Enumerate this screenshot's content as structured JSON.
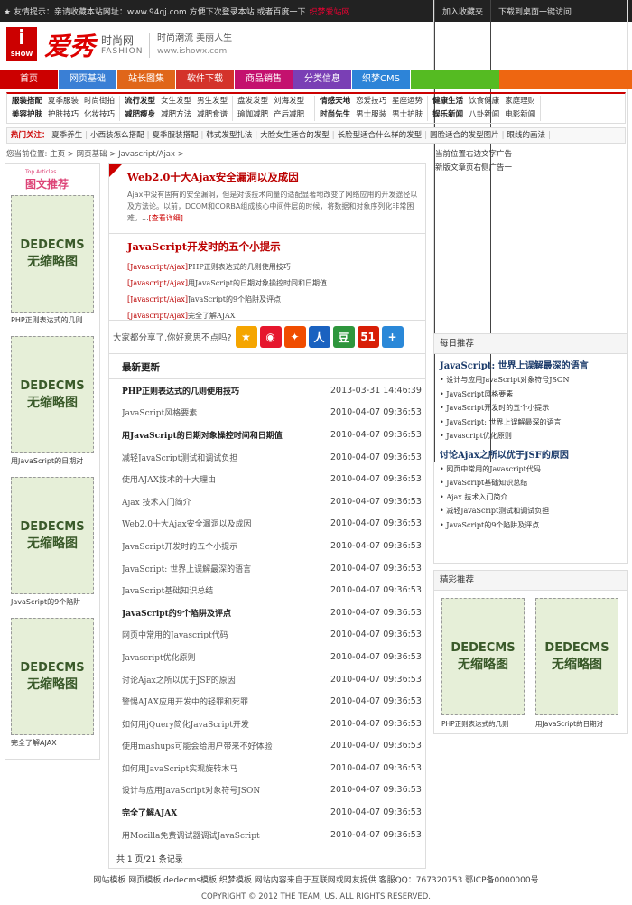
{
  "topbar": {
    "notice": "★ 友情提示：亲请收藏本站网址：www.94qj.com 方便下次登录本站 或者百度一下",
    "highlight": "织梦爱站网",
    "fav": "加入收藏夹",
    "desktop": "下载到桌面一键访问"
  },
  "logo": {
    "i": "i",
    "show": "SHOW",
    "cn": "爱秀",
    "ss": "时尚网",
    "fashion": "FASHION",
    "slogan1": "时尚潮流 美丽人生",
    "slogan2": "www.ishowx.com"
  },
  "nav": [
    {
      "label": "首页",
      "color": "#cc0000"
    },
    {
      "label": "网页基础",
      "color": "#3a7fd5"
    },
    {
      "label": "站长图集",
      "color": "#e0661a"
    },
    {
      "label": "软件下载",
      "color": "#d4332a"
    },
    {
      "label": "商品销售",
      "color": "#c4116e"
    },
    {
      "label": "分类信息",
      "color": "#7a3fb5"
    },
    {
      "label": "织梦CMS",
      "color": "#2d84d8"
    }
  ],
  "subnav": [
    [
      "服装搭配",
      "夏季服装",
      "时尚街拍",
      "美容护肤",
      "护肤技巧",
      "化妆技巧"
    ],
    [
      "流行发型",
      "女生发型",
      "男生发型",
      "减肥瘦身",
      "减肥方法",
      "减肥食谱"
    ],
    [
      "盘发发型",
      "刘海发型",
      "",
      "瑜伽减肥",
      "产后减肥",
      ""
    ],
    [
      "情感天地",
      "恋爱技巧",
      "星座运势",
      "时尚先生",
      "男士服装",
      "男士护肤"
    ],
    [
      "健康生活",
      "饮食健康",
      "家庭理财",
      "娱乐新闻",
      "八卦新闻",
      "电影新闻"
    ]
  ],
  "hot": {
    "label": "热门关注：",
    "items": [
      "夏季养生",
      "小西装怎么搭配",
      "夏季服装搭配",
      "韩式发型扎法",
      "大脸女生适合的发型",
      "长脸型适合什么样的发型",
      "圆脸适合的发型图片",
      "眼线的画法"
    ]
  },
  "crumb": "您当前位置: 主页 > 网页基础 > Javascript/Ajax >",
  "ads": {
    "a1": "当前位置右边文字广告",
    "a2": "新版文章页右侧广告一"
  },
  "left": {
    "small": "Top Articles",
    "title": "图文推荐",
    "thumb1": "DEDECMS",
    "thumb2": "无缩略图",
    "items": [
      "PHP正则表达式的几则",
      "用JavaScript的日期对",
      "JavaScript的9个陷阱",
      "完全了解AJAX"
    ]
  },
  "featured": {
    "title": "Web2.0十大Ajax安全漏洞以及成因",
    "desc": "Ajax中没有固有的安全漏洞，但是对该技术向量的适配显著地改变了网络应用的开发途径以及方法论。以前，DCOM和CORBA组成核心中间件层的时候，将数据和对象序列化非常困难。...",
    "more": "[查看详细]"
  },
  "tips": {
    "title": "JavaScript开发时的五个小提示",
    "rows": [
      {
        "tag": "[Javascript/Ajax]",
        "text": "PHP正则表达式的几则使用技巧"
      },
      {
        "tag": "[Javascript/Ajax]",
        "text": "用JavaScript的日期对象操控时间和日期值"
      },
      {
        "tag": "[Javascript/Ajax]",
        "text": "JavaScript的9个陷阱及评点"
      },
      {
        "tag": "[Javascript/Ajax]",
        "text": "完全了解AJAX"
      }
    ]
  },
  "share": {
    "text": "大家都分享了,你好意思不点吗?",
    "icons": [
      {
        "name": "qzone-icon",
        "glyph": "★",
        "color": "#f5a500"
      },
      {
        "name": "weibo-icon",
        "glyph": "◉",
        "color": "#e6162d"
      },
      {
        "name": "tencent-weibo-icon",
        "glyph": "✦",
        "color": "#f04c00"
      },
      {
        "name": "renren-icon",
        "glyph": "人",
        "color": "#1a62c0"
      },
      {
        "name": "douban-icon",
        "glyph": "豆",
        "color": "#2e963d"
      },
      {
        "name": "kaixin-icon",
        "glyph": "51",
        "color": "#d81e06"
      },
      {
        "name": "more-share-icon",
        "glyph": "+",
        "color": "#2a88d8"
      }
    ]
  },
  "latest": {
    "title": "最新更新",
    "rows": [
      {
        "title": "PHP正则表达式的几则使用技巧",
        "date": "2013-03-31 14:46:39",
        "bold": true
      },
      {
        "title": "JavaScript风格要素",
        "date": "2010-04-07 09:36:53",
        "bold": false
      },
      {
        "title": "用JavaScript的日期对象操控时间和日期值",
        "date": "2010-04-07 09:36:53",
        "bold": true
      },
      {
        "title": "减轻JavaScript测试和调试负担",
        "date": "2010-04-07 09:36:53",
        "bold": false
      },
      {
        "title": "使用AJAX技术的十大理由",
        "date": "2010-04-07 09:36:53",
        "bold": false
      },
      {
        "title": "Ajax 技术入门简介",
        "date": "2010-04-07 09:36:53",
        "bold": false
      },
      {
        "title": "Web2.0十大Ajax安全漏洞以及成因",
        "date": "2010-04-07 09:36:53",
        "bold": false
      },
      {
        "title": "JavaScript开发时的五个小提示",
        "date": "2010-04-07 09:36:53",
        "bold": false
      },
      {
        "title": "JavaScript: 世界上误解最深的语言",
        "date": "2010-04-07 09:36:53",
        "bold": false
      },
      {
        "title": "JavaScript基础知识总结",
        "date": "2010-04-07 09:36:53",
        "bold": false
      },
      {
        "title": "JavaScript的9个陷阱及评点",
        "date": "2010-04-07 09:36:53",
        "bold": true
      },
      {
        "title": "网页中常用的Javascript代码",
        "date": "2010-04-07 09:36:53",
        "bold": false
      },
      {
        "title": "Javascript优化原则",
        "date": "2010-04-07 09:36:53",
        "bold": false
      },
      {
        "title": "讨论Ajax之所以优于JSF的原因",
        "date": "2010-04-07 09:36:53",
        "bold": false
      },
      {
        "title": "警惕AJAX应用开发中的轻罪和死罪",
        "date": "2010-04-07 09:36:53",
        "bold": false
      },
      {
        "title": "如何用jQuery简化JavaScript开发",
        "date": "2010-04-07 09:36:53",
        "bold": false
      },
      {
        "title": "使用mashups可能会给用户带来不好体验",
        "date": "2010-04-07 09:36:53",
        "bold": false
      },
      {
        "title": "如何用JavaScript实现旋转木马",
        "date": "2010-04-07 09:36:53",
        "bold": false
      },
      {
        "title": "设计与应用JavaScript对象符号JSON",
        "date": "2010-04-07 09:36:53",
        "bold": false
      },
      {
        "title": "完全了解AJAX",
        "date": "2010-04-07 09:36:53",
        "bold": true
      },
      {
        "title": "用Mozilla免费调试器调试JavaScript",
        "date": "2010-04-07 09:36:53",
        "bold": false
      }
    ]
  },
  "pager": "共 1 页/21 条记录",
  "daily": {
    "title": "每日推荐",
    "h1": "JavaScript: 世界上误解最深的语言",
    "l1": [
      "设计与应用JavaScript对象符号JSON",
      "JavaScript风格要素",
      "JavaScript开发时的五个小提示",
      "JavaScript: 世界上误解最深的语言",
      "Javascript优化原则"
    ],
    "h2": "讨论Ajax之所以优于JSF的原因",
    "l2": [
      "网页中常用的Javascript代码",
      "JavaScript基础知识总结",
      "Ajax 技术入门简介",
      "减轻JavaScript测试和调试负担",
      "JavaScript的9个陷阱及评点"
    ]
  },
  "picks": {
    "title": "精彩推荐",
    "items": [
      "PHP正则表达式的几则",
      "用JavaScript的日期对"
    ]
  },
  "footer": {
    "links": "网站模板 网页模板 dedecms模板 织梦模板 网站内容来自于互联网或网友提供 客服QQ：767320753 鄂ICP备0000000号",
    "copy": "COPYRIGHT © 2012 THE TEAM, US. ALL RIGHTS RESERVED."
  }
}
